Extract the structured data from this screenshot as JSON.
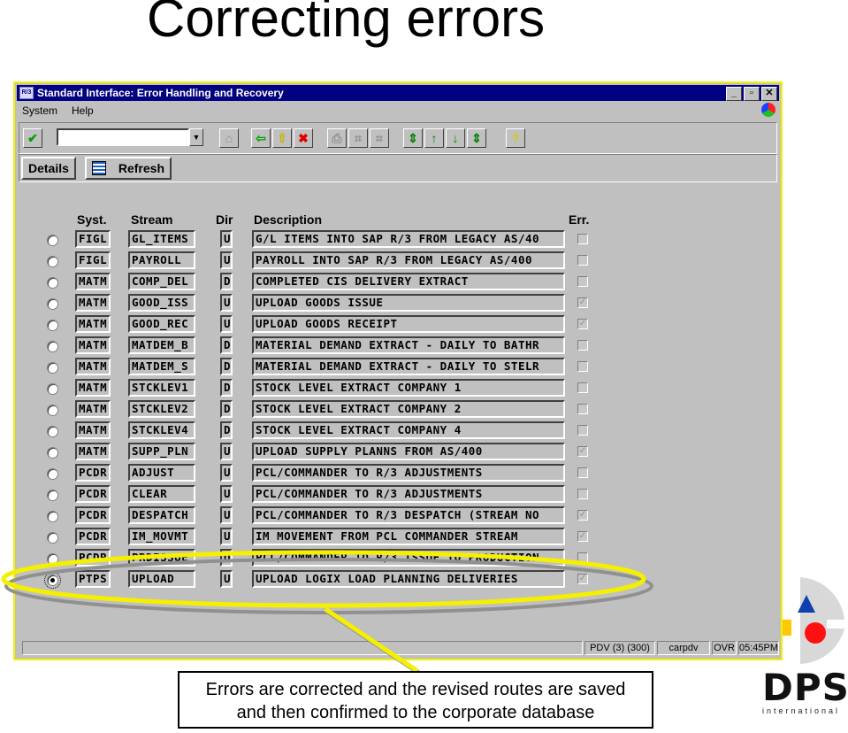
{
  "slide": {
    "title": "Correcting errors",
    "callout_line1": "Errors are corrected and the revised routes are saved",
    "callout_line2": "and then confirmed to the corporate database",
    "logo": {
      "name": "DPS",
      "subtitle": "international"
    }
  },
  "window": {
    "app_icon": "R/3",
    "title": "Standard Interface: Error Handling and Recovery",
    "controls": {
      "minimize": "_",
      "restore": "▫",
      "close": "✕"
    },
    "menu": [
      "System",
      "Help"
    ],
    "toolbar": {
      "command_field_value": "",
      "buttons": [
        {
          "name": "enter-icon",
          "glyph": "✔",
          "color": "#00a000",
          "enabled": true
        },
        {
          "name": "save-icon",
          "glyph": "⌂",
          "color": "#909090",
          "enabled": false
        },
        {
          "name": "back-icon",
          "glyph": "⇦",
          "color": "#00a000",
          "enabled": true
        },
        {
          "name": "exit-icon",
          "glyph": "⇧",
          "color": "#c8b400",
          "enabled": true
        },
        {
          "name": "cancel-icon",
          "glyph": "✖",
          "color": "#e00000",
          "enabled": true
        },
        {
          "name": "print-icon",
          "glyph": "⎙",
          "color": "#909090",
          "enabled": false
        },
        {
          "name": "find-icon",
          "glyph": "⌗",
          "color": "#909090",
          "enabled": false
        },
        {
          "name": "find-next-icon",
          "glyph": "⌗",
          "color": "#909090",
          "enabled": false
        },
        {
          "name": "first-page-icon",
          "glyph": "⇕",
          "color": "#008000",
          "enabled": true
        },
        {
          "name": "previous-page-icon",
          "glyph": "↑",
          "color": "#008000",
          "enabled": true
        },
        {
          "name": "next-page-icon",
          "glyph": "↓",
          "color": "#008000",
          "enabled": true
        },
        {
          "name": "last-page-icon",
          "glyph": "⇕",
          "color": "#008000",
          "enabled": true
        },
        {
          "name": "help-icon",
          "glyph": "?",
          "color": "#d8c800",
          "enabled": true
        }
      ]
    },
    "app_toolbar": {
      "details": "Details",
      "refresh": "Refresh"
    },
    "columns": {
      "syst": "Syst.",
      "stream": "Stream",
      "dir": "Dir",
      "description": "Description",
      "err": "Err."
    },
    "rows": [
      {
        "selected": false,
        "syst": "FIGL",
        "stream": "GL_ITEMS",
        "dir": "U",
        "description": "G/L ITEMS INTO SAP R/3 FROM LEGACY AS/40",
        "err": false
      },
      {
        "selected": false,
        "syst": "FIGL",
        "stream": "PAYROLL",
        "dir": "U",
        "description": "PAYROLL INTO SAP R/3 FROM LEGACY AS/400",
        "err": false
      },
      {
        "selected": false,
        "syst": "MATM",
        "stream": "COMP_DEL",
        "dir": "D",
        "description": "COMPLETED CIS DELIVERY EXTRACT",
        "err": false
      },
      {
        "selected": false,
        "syst": "MATM",
        "stream": "GOOD_ISS",
        "dir": "U",
        "description": "UPLOAD GOODS ISSUE",
        "err": true
      },
      {
        "selected": false,
        "syst": "MATM",
        "stream": "GOOD_REC",
        "dir": "U",
        "description": "UPLOAD GOODS RECEIPT",
        "err": true
      },
      {
        "selected": false,
        "syst": "MATM",
        "stream": "MATDEM_B",
        "dir": "D",
        "description": "MATERIAL DEMAND EXTRACT - DAILY TO BATHR",
        "err": false
      },
      {
        "selected": false,
        "syst": "MATM",
        "stream": "MATDEM_S",
        "dir": "D",
        "description": "MATERIAL DEMAND EXTRACT - DAILY TO STELR",
        "err": false
      },
      {
        "selected": false,
        "syst": "MATM",
        "stream": "STCKLEV1",
        "dir": "D",
        "description": "STOCK LEVEL EXTRACT COMPANY 1",
        "err": false
      },
      {
        "selected": false,
        "syst": "MATM",
        "stream": "STCKLEV2",
        "dir": "D",
        "description": "STOCK LEVEL EXTRACT COMPANY 2",
        "err": false
      },
      {
        "selected": false,
        "syst": "MATM",
        "stream": "STCKLEV4",
        "dir": "D",
        "description": "STOCK LEVEL EXTRACT COMPANY 4",
        "err": false
      },
      {
        "selected": false,
        "syst": "MATM",
        "stream": "SUPP_PLN",
        "dir": "U",
        "description": "UPLOAD SUPPLY PLANNS FROM AS/400",
        "err": true
      },
      {
        "selected": false,
        "syst": "PCDR",
        "stream": "ADJUST",
        "dir": "U",
        "description": "PCL/COMMANDER TO R/3 ADJUSTMENTS",
        "err": false
      },
      {
        "selected": false,
        "syst": "PCDR",
        "stream": "CLEAR",
        "dir": "U",
        "description": "PCL/COMMANDER TO R/3 ADJUSTMENTS",
        "err": false
      },
      {
        "selected": false,
        "syst": "PCDR",
        "stream": "DESPATCH",
        "dir": "U",
        "description": "PCL/COMMANDER TO R/3 DESPATCH (STREAM NO",
        "err": true
      },
      {
        "selected": false,
        "syst": "PCDR",
        "stream": "IM_MOVMT",
        "dir": "U",
        "description": "IM MOVEMENT FROM PCL COMMANDER STREAM",
        "err": true
      },
      {
        "selected": false,
        "syst": "PCDR",
        "stream": "PRDISSUE",
        "dir": "U",
        "description": "PCL/COMMANDER TO R/3 ISSUE TO PRODUCTION",
        "err": false
      },
      {
        "selected": true,
        "syst": "PTPS",
        "stream": "UPLOAD",
        "dir": "U",
        "description": "UPLOAD LOGIX LOAD PLANNING DELIVERIES",
        "err": true
      }
    ],
    "status_bar": {
      "message": "",
      "system": "PDV (3) (300)",
      "server": "carpdv",
      "mode": "OVR",
      "time": "05:45PM"
    }
  },
  "colors": {
    "title_bar": "#000080",
    "window_bg": "#c0c0c0",
    "highlight_ellipse": "#f4f000",
    "logo_blue": "#1040b0",
    "logo_red": "#ff1010",
    "logo_yellow": "#ffc800"
  }
}
